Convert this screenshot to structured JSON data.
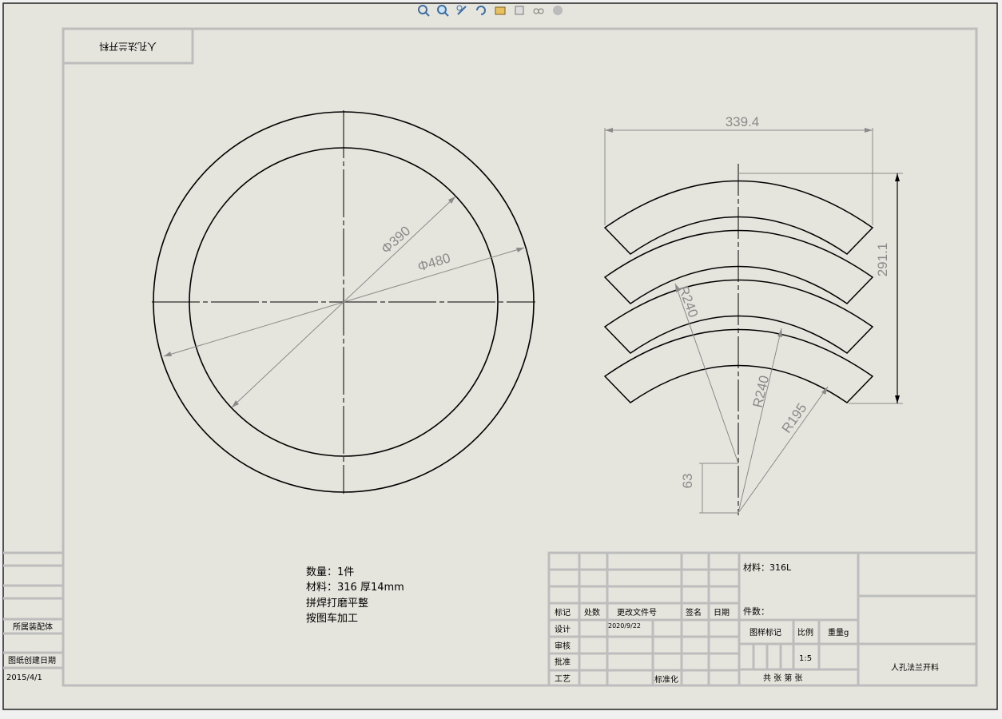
{
  "toolbar": {
    "icons": [
      "zoom-to-fit-icon",
      "zoom-area-icon",
      "pan-icon",
      "rotate-icon",
      "view-settings-icon",
      "display-style-icon",
      "hide-show-icon",
      "appearance-icon"
    ]
  },
  "drawing": {
    "top_tab_text": "人孔法兰开料",
    "dimensions": {
      "inner_diameter": "Φ390",
      "outer_diameter": "Φ480",
      "width": "339.4",
      "height": "291.1",
      "radius_outer_1": "R240",
      "radius_outer_2": "R240",
      "radius_inner": "R195",
      "offset": "63"
    },
    "notes": [
      "数量：1件",
      "材料：316    厚14mm",
      "拼焊打磨平整",
      "按图车加工"
    ]
  },
  "left_block": {
    "assembly_label": "所属装配体",
    "created_label": "图纸创建日期",
    "created_date": "2015/4/1"
  },
  "title_block": {
    "headers": [
      "标记",
      "处数",
      "更改文件号",
      "签名",
      "日期"
    ],
    "rows": [
      "设计",
      "审核",
      "批准",
      "工艺"
    ],
    "design_date": "2020/9/22",
    "standardize": "标准化",
    "material": "材料：316L",
    "count": "件数：",
    "stage_label": "图样标记",
    "scale_label": "比例",
    "weight_label": "重量g",
    "scale_value": "1:5",
    "sheets": "共  张   第  张",
    "part_name": "人孔法兰开料"
  }
}
